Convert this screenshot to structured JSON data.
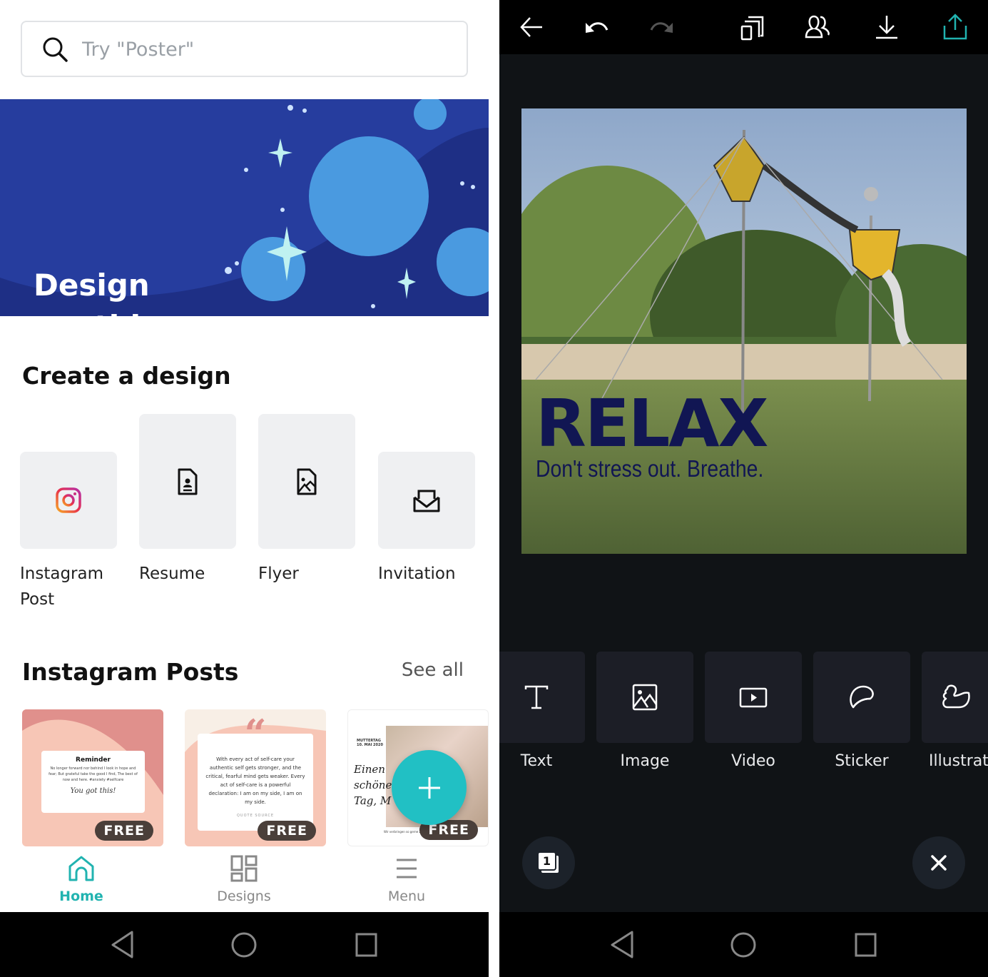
{
  "left": {
    "search": {
      "placeholder": "Try \"Poster\"",
      "value": ""
    },
    "banner": {
      "title_line1": "Design",
      "title_line2": "anything."
    },
    "create_section": {
      "title": "Create a design",
      "items": [
        {
          "label": "Instagram Post",
          "icon": "instagram-icon"
        },
        {
          "label": "Resume",
          "icon": "resume-document-icon"
        },
        {
          "label": "Flyer",
          "icon": "flyer-document-icon"
        },
        {
          "label": "Invitation",
          "icon": "envelope-icon"
        }
      ]
    },
    "instagram_section": {
      "title": "Instagram Posts",
      "see_all": "See all",
      "templates": [
        {
          "badge": "FREE",
          "heading": "Reminder",
          "body": "No longer forward nor behind I look in hope and fear; But grateful take the good I find, The best of now and here. #anxiety #selfcare",
          "signature": "You got this!"
        },
        {
          "badge": "FREE",
          "quote_mark": "“",
          "body": "With every act of self-care your authentic self gets stronger, and the critical, fearful mind gets weaker. Every act of self-care is a powerful declaration: I am on my side, I am on my side.",
          "source": "QUOTE SOURCE"
        },
        {
          "badge": "FREE",
          "date_line1": "MUTTERTAG",
          "date_line2": "10. MAI 2020",
          "script": "Einen schönen Tag, M",
          "footer": "Wir verbringen so gerne Zeit mit dir"
        }
      ]
    },
    "fab": {
      "icon": "plus-icon"
    },
    "bottom_nav": [
      {
        "label": "Home",
        "icon": "home-icon",
        "active": true
      },
      {
        "label": "Designs",
        "icon": "designs-grid-icon",
        "active": false
      },
      {
        "label": "Menu",
        "icon": "menu-icon",
        "active": false
      }
    ]
  },
  "right": {
    "toolbar": [
      "back-arrow-icon",
      "undo-icon",
      "redo-icon",
      "resize-icon",
      "collaborate-icon",
      "download-icon",
      "share-icon"
    ],
    "canvas": {
      "headline": "RELAX",
      "subline": "Don't stress out. Breathe."
    },
    "tools": [
      {
        "label": "Text",
        "icon": "text-icon"
      },
      {
        "label": "Image",
        "icon": "image-icon"
      },
      {
        "label": "Video",
        "icon": "video-icon"
      },
      {
        "label": "Sticker",
        "icon": "sticker-icon"
      },
      {
        "label": "Illustrat",
        "icon": "illustration-duck-icon"
      }
    ],
    "page_count": "1"
  },
  "colors": {
    "accent_teal": "#21c0c4",
    "banner_blue": "#263d9e",
    "headline_navy": "#111653",
    "editor_bg": "#101316"
  }
}
